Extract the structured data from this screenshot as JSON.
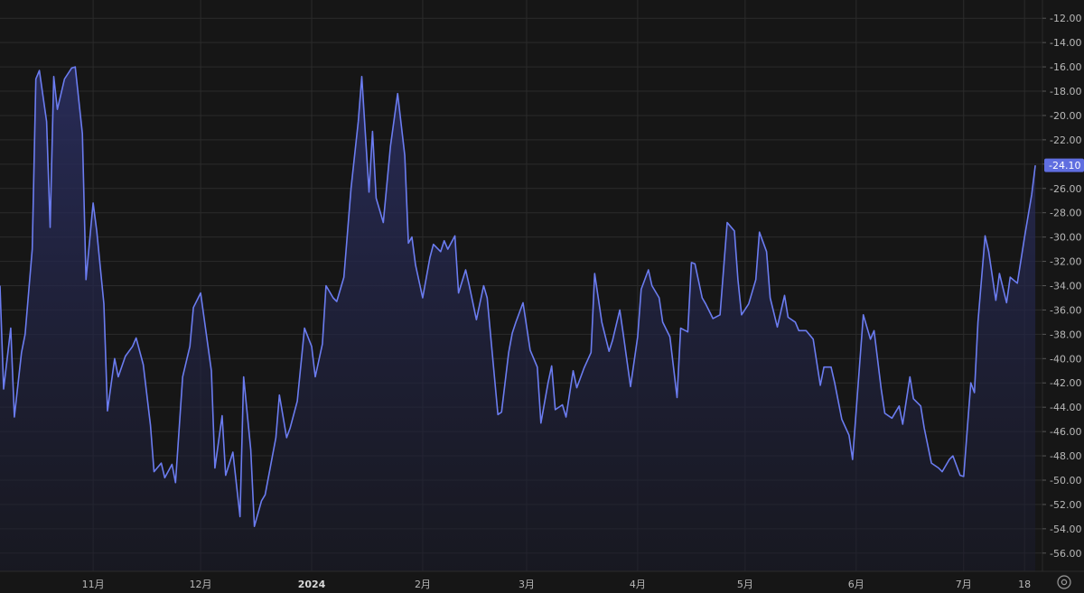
{
  "chart_data": {
    "type": "area",
    "title": "",
    "xlabel": "",
    "ylabel": "",
    "ylim": [
      -57.5,
      -10.5
    ],
    "y_ticks": [
      -12,
      -14,
      -16,
      -18,
      -20,
      -22,
      -24,
      -26,
      -28,
      -30,
      -32,
      -34,
      -36,
      -38,
      -40,
      -42,
      -44,
      -46,
      -48,
      -50,
      -52,
      -54,
      -56
    ],
    "y_tick_labels": [
      "-12.00",
      "-14.00",
      "-16.00",
      "-18.00",
      "-20.00",
      "-22.00",
      "-24.00",
      "-26.00",
      "-28.00",
      "-30.00",
      "-32.00",
      "-34.00",
      "-36.00",
      "-38.00",
      "-40.00",
      "-42.00",
      "-44.00",
      "-46.00",
      "-48.00",
      "-50.00",
      "-52.00",
      "-54.00",
      "-56.00"
    ],
    "x_range": [
      "2023-10-06",
      "2024-07-23"
    ],
    "x_ticks": [
      {
        "date": "2023-11-01",
        "label": "11月",
        "bold": false
      },
      {
        "date": "2023-12-01",
        "label": "12月",
        "bold": false
      },
      {
        "date": "2024-01-01",
        "label": "2024",
        "bold": true
      },
      {
        "date": "2024-02-01",
        "label": "2月",
        "bold": false
      },
      {
        "date": "2024-03-01",
        "label": "3月",
        "bold": false
      },
      {
        "date": "2024-04-01",
        "label": "4月",
        "bold": false
      },
      {
        "date": "2024-05-01",
        "label": "5月",
        "bold": false
      },
      {
        "date": "2024-06-01",
        "label": "6月",
        "bold": false
      },
      {
        "date": "2024-07-01",
        "label": "7月",
        "bold": false
      },
      {
        "date": "2024-07-18",
        "label": "18",
        "bold": false
      }
    ],
    "series": [
      {
        "color": "#6b7cf0",
        "points": [
          [
            "2023-10-06",
            -34.0
          ],
          [
            "2023-10-07",
            -42.5
          ],
          [
            "2023-10-09",
            -37.5
          ],
          [
            "2023-10-10",
            -44.8
          ],
          [
            "2023-10-12",
            -39.5
          ],
          [
            "2023-10-13",
            -38.0
          ],
          [
            "2023-10-15",
            -31.0
          ],
          [
            "2023-10-16",
            -17.0
          ],
          [
            "2023-10-17",
            -16.3
          ],
          [
            "2023-10-19",
            -20.5
          ],
          [
            "2023-10-20",
            -29.2
          ],
          [
            "2023-10-21",
            -16.8
          ],
          [
            "2023-10-22",
            -19.5
          ],
          [
            "2023-10-24",
            -17.0
          ],
          [
            "2023-10-26",
            -16.1
          ],
          [
            "2023-10-27",
            -16.0
          ],
          [
            "2023-10-29",
            -21.5
          ],
          [
            "2023-10-30",
            -33.5
          ],
          [
            "2023-11-01",
            -27.2
          ],
          [
            "2023-11-02",
            -29.5
          ],
          [
            "2023-11-04",
            -35.5
          ],
          [
            "2023-11-05",
            -44.3
          ],
          [
            "2023-11-07",
            -40.0
          ],
          [
            "2023-11-08",
            -41.5
          ],
          [
            "2023-11-10",
            -39.8
          ],
          [
            "2023-11-12",
            -39.0
          ],
          [
            "2023-11-13",
            -38.3
          ],
          [
            "2023-11-15",
            -40.5
          ],
          [
            "2023-11-17",
            -45.5
          ],
          [
            "2023-11-18",
            -49.3
          ],
          [
            "2023-11-20",
            -48.6
          ],
          [
            "2023-11-21",
            -49.8
          ],
          [
            "2023-11-23",
            -48.7
          ],
          [
            "2023-11-24",
            -50.2
          ],
          [
            "2023-11-26",
            -41.5
          ],
          [
            "2023-11-28",
            -39.0
          ],
          [
            "2023-11-29",
            -35.8
          ],
          [
            "2023-12-01",
            -34.6
          ],
          [
            "2023-12-04",
            -41.0
          ],
          [
            "2023-12-05",
            -49.0
          ],
          [
            "2023-12-07",
            -44.7
          ],
          [
            "2023-12-08",
            -49.6
          ],
          [
            "2023-12-10",
            -47.7
          ],
          [
            "2023-12-12",
            -53.0
          ],
          [
            "2023-12-13",
            -41.5
          ],
          [
            "2023-12-15",
            -47.5
          ],
          [
            "2023-12-16",
            -53.8
          ],
          [
            "2023-12-18",
            -51.7
          ],
          [
            "2023-12-19",
            -51.2
          ],
          [
            "2023-12-22",
            -46.5
          ],
          [
            "2023-12-23",
            -43.0
          ],
          [
            "2023-12-25",
            -46.5
          ],
          [
            "2023-12-26",
            -45.7
          ],
          [
            "2023-12-28",
            -43.5
          ],
          [
            "2023-12-30",
            -37.5
          ],
          [
            "2024-01-01",
            -39.0
          ],
          [
            "2024-01-02",
            -41.5
          ],
          [
            "2024-01-04",
            -38.8
          ],
          [
            "2024-01-05",
            -34.0
          ],
          [
            "2024-01-07",
            -35.0
          ],
          [
            "2024-01-08",
            -35.3
          ],
          [
            "2024-01-10",
            -33.3
          ],
          [
            "2024-01-12",
            -26.0
          ],
          [
            "2024-01-14",
            -20.5
          ],
          [
            "2024-01-15",
            -16.8
          ],
          [
            "2024-01-17",
            -26.3
          ],
          [
            "2024-01-18",
            -21.3
          ],
          [
            "2024-01-19",
            -26.8
          ],
          [
            "2024-01-21",
            -28.8
          ],
          [
            "2024-01-23",
            -22.5
          ],
          [
            "2024-01-25",
            -18.2
          ],
          [
            "2024-01-27",
            -23.3
          ],
          [
            "2024-01-28",
            -30.5
          ],
          [
            "2024-01-29",
            -30.0
          ],
          [
            "2024-01-30",
            -32.3
          ],
          [
            "2024-02-01",
            -35.0
          ],
          [
            "2024-02-03",
            -31.7
          ],
          [
            "2024-02-04",
            -30.6
          ],
          [
            "2024-02-06",
            -31.2
          ],
          [
            "2024-02-07",
            -30.3
          ],
          [
            "2024-02-08",
            -31.0
          ],
          [
            "2024-02-10",
            -29.9
          ],
          [
            "2024-02-11",
            -34.6
          ],
          [
            "2024-02-13",
            -32.7
          ],
          [
            "2024-02-14",
            -34.0
          ],
          [
            "2024-02-16",
            -36.8
          ],
          [
            "2024-02-18",
            -34.0
          ],
          [
            "2024-02-19",
            -35.0
          ],
          [
            "2024-02-22",
            -44.6
          ],
          [
            "2024-02-23",
            -44.4
          ],
          [
            "2024-02-25",
            -39.5
          ],
          [
            "2024-02-26",
            -37.9
          ],
          [
            "2024-02-27",
            -37.0
          ],
          [
            "2024-02-29",
            -35.4
          ],
          [
            "2024-03-02",
            -39.3
          ],
          [
            "2024-03-04",
            -40.7
          ],
          [
            "2024-03-05",
            -45.3
          ],
          [
            "2024-03-07",
            -42.0
          ],
          [
            "2024-03-08",
            -40.6
          ],
          [
            "2024-03-09",
            -44.2
          ],
          [
            "2024-03-11",
            -43.8
          ],
          [
            "2024-03-12",
            -44.8
          ],
          [
            "2024-03-14",
            -41.0
          ],
          [
            "2024-03-15",
            -42.4
          ],
          [
            "2024-03-17",
            -40.8
          ],
          [
            "2024-03-19",
            -39.5
          ],
          [
            "2024-03-20",
            -33.0
          ],
          [
            "2024-03-22",
            -37.0
          ],
          [
            "2024-03-24",
            -39.4
          ],
          [
            "2024-03-25",
            -38.5
          ],
          [
            "2024-03-27",
            -36.0
          ],
          [
            "2024-03-28",
            -38.0
          ],
          [
            "2024-03-30",
            -42.3
          ],
          [
            "2024-04-01",
            -38.2
          ],
          [
            "2024-04-02",
            -34.3
          ],
          [
            "2024-04-04",
            -32.7
          ],
          [
            "2024-04-05",
            -34.0
          ],
          [
            "2024-04-07",
            -35.0
          ],
          [
            "2024-04-08",
            -37.0
          ],
          [
            "2024-04-10",
            -38.2
          ],
          [
            "2024-04-12",
            -43.2
          ],
          [
            "2024-04-13",
            -37.5
          ],
          [
            "2024-04-15",
            -37.8
          ],
          [
            "2024-04-16",
            -32.1
          ],
          [
            "2024-04-17",
            -32.2
          ],
          [
            "2024-04-19",
            -35.0
          ],
          [
            "2024-04-20",
            -35.5
          ],
          [
            "2024-04-22",
            -36.7
          ],
          [
            "2024-04-24",
            -36.4
          ],
          [
            "2024-04-26",
            -28.8
          ],
          [
            "2024-04-28",
            -29.5
          ],
          [
            "2024-04-29",
            -33.5
          ],
          [
            "2024-04-30",
            -36.4
          ],
          [
            "2024-05-02",
            -35.5
          ],
          [
            "2024-05-04",
            -33.5
          ],
          [
            "2024-05-05",
            -29.6
          ],
          [
            "2024-05-07",
            -31.2
          ],
          [
            "2024-05-08",
            -35.0
          ],
          [
            "2024-05-10",
            -37.4
          ],
          [
            "2024-05-12",
            -34.8
          ],
          [
            "2024-05-13",
            -36.6
          ],
          [
            "2024-05-15",
            -37.0
          ],
          [
            "2024-05-16",
            -37.7
          ],
          [
            "2024-05-18",
            -37.7
          ],
          [
            "2024-05-20",
            -38.4
          ],
          [
            "2024-05-22",
            -42.2
          ],
          [
            "2024-05-23",
            -40.7
          ],
          [
            "2024-05-25",
            -40.7
          ],
          [
            "2024-05-26",
            -42.0
          ],
          [
            "2024-05-28",
            -45.0
          ],
          [
            "2024-05-30",
            -46.3
          ],
          [
            "2024-05-31",
            -48.3
          ],
          [
            "2024-06-03",
            -36.4
          ],
          [
            "2024-06-05",
            -38.4
          ],
          [
            "2024-06-06",
            -37.7
          ],
          [
            "2024-06-08",
            -42.5
          ],
          [
            "2024-06-09",
            -44.5
          ],
          [
            "2024-06-11",
            -44.9
          ],
          [
            "2024-06-13",
            -43.9
          ],
          [
            "2024-06-14",
            -45.4
          ],
          [
            "2024-06-16",
            -41.5
          ],
          [
            "2024-06-17",
            -43.3
          ],
          [
            "2024-06-19",
            -43.9
          ],
          [
            "2024-06-20",
            -45.7
          ],
          [
            "2024-06-22",
            -48.6
          ],
          [
            "2024-06-24",
            -49.0
          ],
          [
            "2024-06-25",
            -49.3
          ],
          [
            "2024-06-27",
            -48.3
          ],
          [
            "2024-06-28",
            -48.0
          ],
          [
            "2024-06-30",
            -49.6
          ],
          [
            "2024-07-01",
            -49.7
          ],
          [
            "2024-07-03",
            -42.0
          ],
          [
            "2024-07-04",
            -42.8
          ],
          [
            "2024-07-05",
            -37.0
          ],
          [
            "2024-07-07",
            -29.9
          ],
          [
            "2024-07-08",
            -31.2
          ],
          [
            "2024-07-10",
            -35.2
          ],
          [
            "2024-07-11",
            -33.0
          ],
          [
            "2024-07-13",
            -35.4
          ],
          [
            "2024-07-14",
            -33.3
          ],
          [
            "2024-07-16",
            -33.8
          ],
          [
            "2024-07-18",
            -30.0
          ],
          [
            "2024-07-20",
            -26.5
          ],
          [
            "2024-07-21",
            -24.1
          ]
        ]
      }
    ],
    "last_value_label": "-24.10",
    "last_value_color": "#5f6ee0",
    "grid": true,
    "background": "#161616",
    "line_color": "#6b7cf0",
    "area_fill_top": "#2b2f63",
    "area_fill_bottom": "#1a1b2c",
    "settings_icon": "settings-gear-icon"
  }
}
